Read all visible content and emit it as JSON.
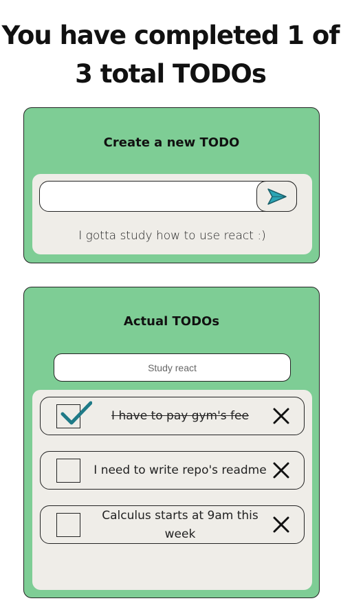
{
  "header": {
    "title_line1": "You have completed 1 of",
    "title_line2": "3 total TODOs"
  },
  "create": {
    "heading": "Create a new TODO",
    "input_value": "",
    "send_icon": "send-icon",
    "helper_text": "I gotta study how to use react :)"
  },
  "list": {
    "heading": "Actual TODOs",
    "search_placeholder": "Study react",
    "items": [
      {
        "text": "I have to pay gym's fee",
        "completed": true
      },
      {
        "text": "I need to write repo's readme",
        "completed": false
      },
      {
        "text": "Calculus starts at 9am this week",
        "completed": false
      }
    ]
  },
  "colors": {
    "card_green": "#7ecd95",
    "inner_bg": "#efede8",
    "accent_teal": "#1f8a96",
    "send_teal": "#2ba5b5"
  }
}
